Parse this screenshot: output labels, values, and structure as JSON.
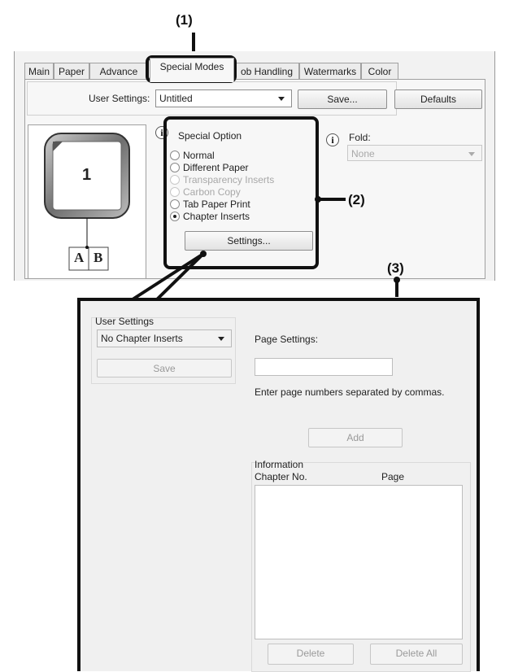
{
  "callouts": {
    "c1": "(1)",
    "c2": "(2)",
    "c3": "(3)"
  },
  "top_dialog": {
    "tabs": [
      "Main",
      "Paper",
      "Advance",
      "Special Modes",
      "ob Handling",
      "Watermarks",
      "Color"
    ],
    "active_tab": "Special Modes",
    "user_settings_label": "User Settings:",
    "user_settings_value": "Untitled",
    "save_label": "Save...",
    "defaults_label": "Defaults",
    "preview_page_number": "1",
    "preview_book_left": "A",
    "preview_book_right": "B",
    "special_option_label": "Special Option",
    "options": [
      {
        "label": "Normal",
        "enabled": true,
        "selected": false
      },
      {
        "label": "Different Paper",
        "enabled": true,
        "selected": false
      },
      {
        "label": "Transparency Inserts",
        "enabled": false,
        "selected": false
      },
      {
        "label": "Carbon Copy",
        "enabled": false,
        "selected": false
      },
      {
        "label": "Tab Paper Print",
        "enabled": true,
        "selected": false
      },
      {
        "label": "Chapter Inserts",
        "enabled": true,
        "selected": true
      }
    ],
    "settings_label": "Settings...",
    "fold_label": "Fold:",
    "fold_value": "None",
    "info_icon_glyph": "i"
  },
  "bottom_dialog": {
    "user_settings_group": "User Settings",
    "user_settings_value": "No Chapter Inserts",
    "save_label": "Save",
    "page_settings_label": "Page Settings:",
    "page_settings_value": "",
    "hint": "Enter page numbers separated by commas.",
    "add_label": "Add",
    "information_label": "Information",
    "col_chapter": "Chapter No.",
    "col_page": "Page",
    "delete_label": "Delete",
    "delete_all_label": "Delete All"
  },
  "colors": {
    "highlight": "#111111",
    "dialog_bg": "#f0f0f0",
    "disabled_text": "#a8a8a8"
  }
}
